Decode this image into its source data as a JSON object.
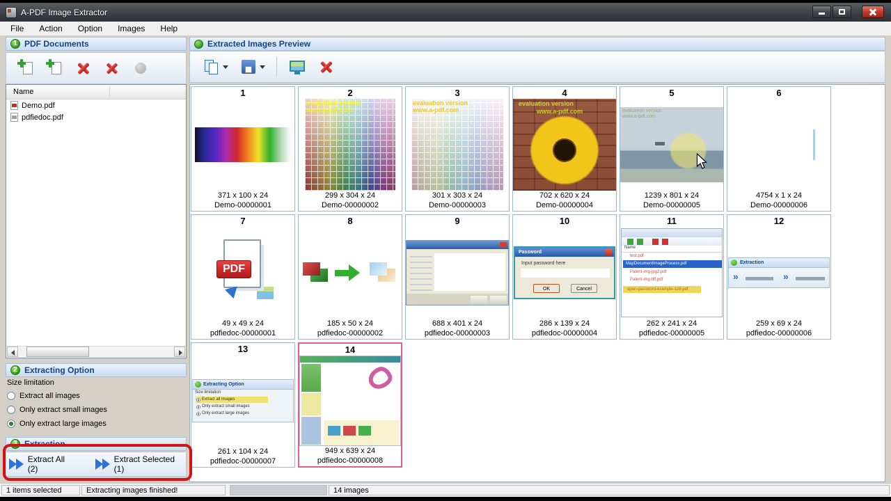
{
  "window": {
    "title": "A-PDF Image Extractor"
  },
  "menu": {
    "items": [
      "File",
      "Action",
      "Option",
      "Images",
      "Help"
    ]
  },
  "left_panel": {
    "header": {
      "step": "1",
      "title": "PDF Documents"
    },
    "toolbar": [
      {
        "icon": "add-pdf-icon"
      },
      {
        "icon": "add-pdf-batch-icon"
      },
      {
        "icon": "remove-pdf-icon"
      },
      {
        "icon": "remove-all-pdf-icon"
      },
      {
        "icon": "move-disabled-icon"
      }
    ],
    "list": {
      "column_header": "Name",
      "items": [
        {
          "name": "Demo.pdf",
          "icon": "pdf-file-red-icon"
        },
        {
          "name": "pdfiedoc.pdf",
          "icon": "pdf-file-gray-icon"
        }
      ]
    },
    "extracting_option": {
      "step": "2",
      "title": "Extracting Option",
      "group_label": "Size limitation",
      "options": [
        {
          "label": "Extract all images",
          "selected": false
        },
        {
          "label": "Only extract small images",
          "selected": false
        },
        {
          "label": "Only extract large images",
          "selected": true
        }
      ]
    },
    "extraction": {
      "step": "3",
      "title": "Extraction",
      "buttons": [
        {
          "label": "Extract All (2)"
        },
        {
          "label": "Extract Selected (1)"
        }
      ]
    }
  },
  "right_panel": {
    "header": {
      "title": "Extracted Images Preview"
    },
    "toolbar": [
      {
        "icon": "copy-image-icon",
        "dropdown": true
      },
      {
        "icon": "save-image-icon",
        "dropdown": true
      },
      {
        "icon": "preview-image-icon"
      },
      {
        "icon": "delete-image-icon"
      }
    ],
    "thumbnails": [
      {
        "num": "1",
        "kind": "spectrum",
        "dims": "371 x 100 x 24",
        "name": "Demo-00000001"
      },
      {
        "num": "2",
        "kind": "palette",
        "dims": "299 x 304 x 24",
        "name": "Demo-00000002",
        "overlays": [
          "evaluation version",
          "www.a-pdf.com"
        ]
      },
      {
        "num": "3",
        "kind": "palette-light",
        "dims": "301 x 303 x 24",
        "name": "Demo-00000003",
        "overlays": [
          "evaluation version",
          "www.a-pdf.com"
        ]
      },
      {
        "num": "4",
        "kind": "sunflower",
        "dims": "702 x 620 x 24",
        "name": "Demo-00000004",
        "overlays": [
          "evaluation version",
          "www.a-pdf.com"
        ]
      },
      {
        "num": "5",
        "kind": "seascape",
        "dims": "1239 x 801 x 24",
        "name": "Demo-00000005",
        "overlays": [
          "evaluation version",
          "www.a-pdf.com"
        ]
      },
      {
        "num": "6",
        "kind": "line",
        "dims": "4754 x 1 x 24",
        "name": "Demo-00000006"
      },
      {
        "num": "7",
        "kind": "pdficon",
        "dims": "49 x 49 x 24",
        "name": "pdfiedoc-00000001",
        "overlays": [
          "PDF"
        ]
      },
      {
        "num": "8",
        "kind": "arrow",
        "dims": "185 x 50 x 24",
        "name": "pdfiedoc-00000002"
      },
      {
        "num": "9",
        "kind": "dialog",
        "dims": "688 x 401 x 24",
        "name": "pdfiedoc-00000003"
      },
      {
        "num": "10",
        "kind": "password",
        "dims": "286 x 139 x 24",
        "name": "pdfiedoc-00000004",
        "overlays": [
          "Password",
          "Input password here",
          "OK",
          "Cancel"
        ]
      },
      {
        "num": "11",
        "kind": "doclist",
        "dims": "262 x 241 x 24",
        "name": "pdfiedoc-00000005",
        "overlays": [
          "Name",
          "test.pdf",
          "MapDocumentImageProcess.pdf",
          "Patent-img-jpg2.pdf",
          "Patent-img-tiff.pdf",
          "open-password-example-128.pdf"
        ]
      },
      {
        "num": "12",
        "kind": "extractbtns",
        "dims": "259 x 69 x 24",
        "name": "pdfiedoc-00000006",
        "overlays": [
          "Extraction",
          "»",
          "»"
        ]
      },
      {
        "num": "13",
        "kind": "options",
        "dims": "261 x 104 x 24",
        "name": "pdfiedoc-00000007",
        "overlays": [
          "Extracting Option",
          "Size limitation",
          "Extract all images",
          "Only extract small images",
          "Only extract large images"
        ]
      },
      {
        "num": "14",
        "kind": "screenshot",
        "dims": "949 x 639 x 24",
        "name": "pdfiedoc-00000008",
        "selected": true
      }
    ]
  },
  "status_bar": {
    "selection": "1 items selected",
    "message": "Extracting images finished!",
    "image_count": "14 images"
  }
}
